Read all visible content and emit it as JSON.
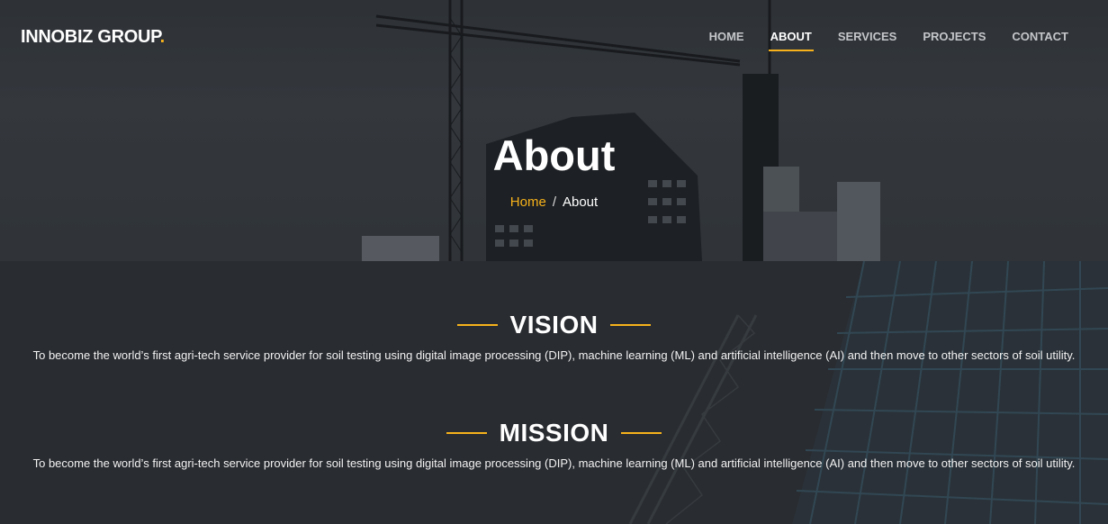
{
  "header": {
    "logo_text": "INNOBIZ GROUP",
    "logo_dot": ".",
    "nav": [
      {
        "label": "HOME",
        "active": false
      },
      {
        "label": "ABOUT",
        "active": true
      },
      {
        "label": "SERVICES",
        "active": false
      },
      {
        "label": "PROJECTS",
        "active": false
      },
      {
        "label": "CONTACT",
        "active": false
      }
    ]
  },
  "hero": {
    "title": "About",
    "breadcrumb": {
      "home": "Home",
      "separator": "/",
      "current": "About"
    }
  },
  "vision": {
    "heading": "VISION",
    "text": "To become the world’s first agri-tech service provider for soil testing using digital image processing (DIP), machine learning (ML) and artificial intelligence (AI) and then move to other sectors of soil utility."
  },
  "mission": {
    "heading": "MISSION",
    "text": "To become the world’s first agri-tech service provider for soil testing using digital image processing (DIP), machine learning (ML) and artificial intelligence (AI) and then move to other sectors of soil utility."
  },
  "colors": {
    "accent": "#f7b21b",
    "overlay": "#2d3035"
  }
}
